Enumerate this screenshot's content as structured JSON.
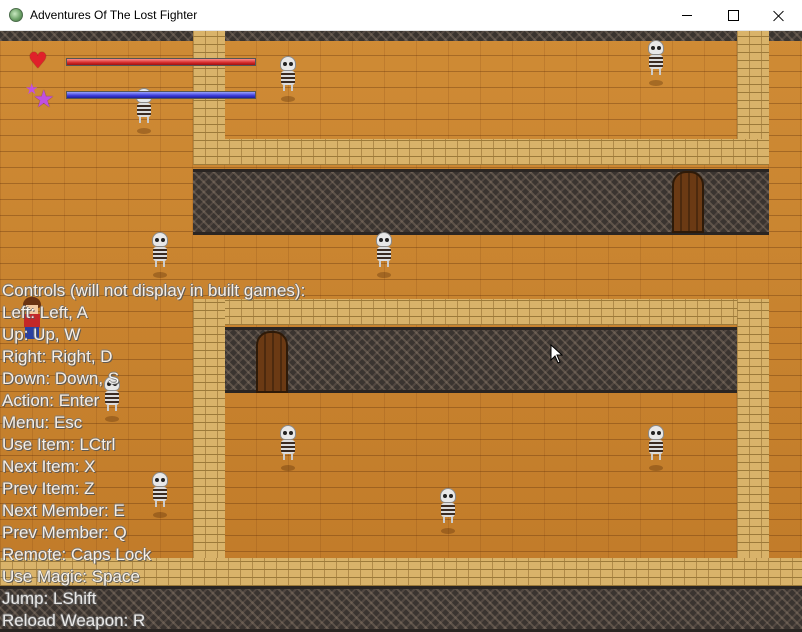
{
  "window": {
    "title": "Adventures Of The Lost Fighter",
    "icon": "game-globe-icon",
    "buttons": [
      "minimize-icon",
      "maximize-icon",
      "close-icon"
    ]
  },
  "hud": {
    "health_icon": "heart-icon",
    "magic_icon": "stars-icon",
    "health_level": 1.0,
    "magic_level": 1.0,
    "colors": {
      "health": "#d42a2a",
      "magic": "#3a3ad8"
    }
  },
  "controls": {
    "header": "Controls (will not display in built games):",
    "items": [
      "Left: Left, A",
      "Up: Up, W",
      "Right: Right, D",
      "Down: Down, S",
      "Action: Enter",
      "Menu: Esc",
      "Use Item: LCtrl",
      "Next Item: X",
      "Prev Item: Z",
      "Next Member: E",
      "Prev Member: Q",
      "Remote: Caps Lock",
      "Use Magic: Space",
      "Jump: LShift",
      "Reload Weapon: R"
    ]
  },
  "scene": {
    "floor_color": "#c8842f",
    "wall_color": "#d9b36a",
    "enemy_type": "skeleton",
    "enemy_count": 10,
    "doors": 2,
    "player": "fighter"
  }
}
